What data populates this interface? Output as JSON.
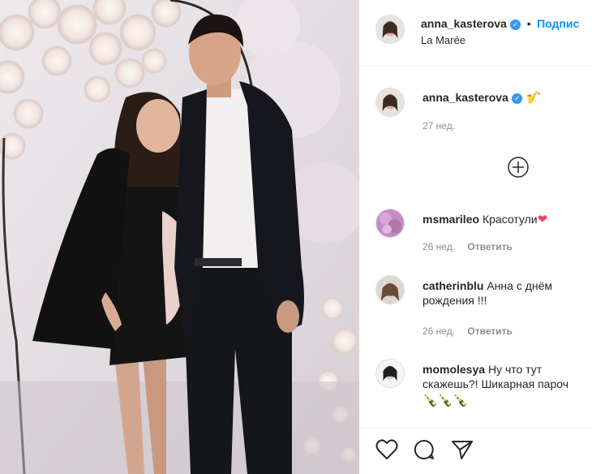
{
  "post": {
    "username": "anna_kasterova",
    "verified_mark": "✓",
    "dot": "•",
    "follow_label": "Подпис",
    "location": "La Marée",
    "image_icon": "photo-image"
  },
  "caption": {
    "username": "anna_kasterova",
    "emoji": "🎷",
    "time": "27 нед."
  },
  "load_more_icon": "plus-circle-icon",
  "comments": [
    {
      "username": "msmarileo",
      "text": "Красотули",
      "emoji": "❤",
      "time": "26 нед.",
      "reply_label": "Ответить"
    },
    {
      "username": "catherinblu",
      "text": "Анна с днём рождения !!!",
      "time": "26 нед.",
      "reply_label": "Ответить"
    },
    {
      "username": "momolesya",
      "text": "Ну что тут скажешь?! Шикарная пароч",
      "emoji": "🍾🍾🍾"
    }
  ],
  "actions": {
    "like_icon": "heart-icon",
    "comment_icon": "comment-icon",
    "share_icon": "share-icon"
  },
  "colors": {
    "link_blue": "#0095f6",
    "verified_blue": "#3897f0",
    "heart_red": "#ed4956"
  }
}
